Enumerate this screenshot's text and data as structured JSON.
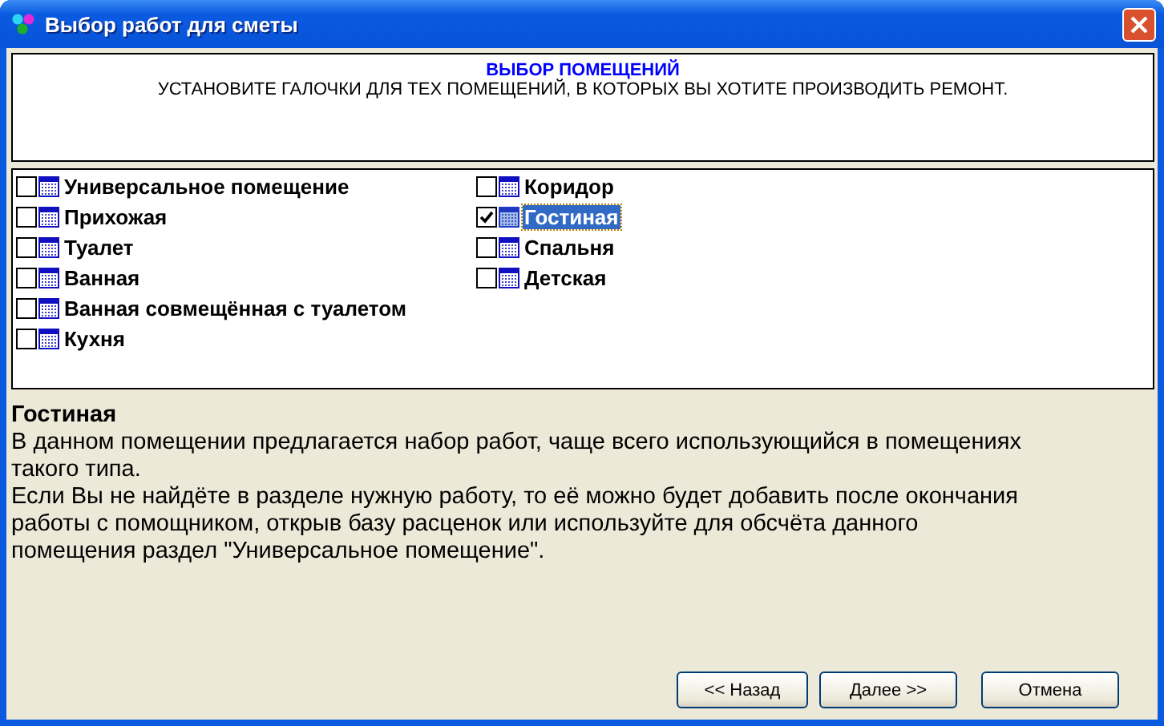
{
  "window": {
    "title": "Выбор работ для сметы"
  },
  "header": {
    "title": "ВЫБОР ПОМЕЩЕНИЙ",
    "instruction": "УСТАНОВИТЕ ГАЛОЧКИ ДЛЯ ТЕХ ПОМЕЩЕНИЙ, В КОТОРЫХ ВЫ ХОТИТЕ ПРОИЗВОДИТЬ РЕМОНТ."
  },
  "rooms": [
    {
      "label": "Универсальное помещение",
      "checked": false,
      "selected": false
    },
    {
      "label": "Прихожая",
      "checked": false,
      "selected": false
    },
    {
      "label": "Туалет",
      "checked": false,
      "selected": false
    },
    {
      "label": "Ванная",
      "checked": false,
      "selected": false
    },
    {
      "label": "Ванная совмещённая с туалетом",
      "checked": false,
      "selected": false
    },
    {
      "label": "Кухня",
      "checked": false,
      "selected": false
    },
    {
      "label": "Коридор",
      "checked": false,
      "selected": false
    },
    {
      "label": "Гостиная",
      "checked": true,
      "selected": true
    },
    {
      "label": "Спальня",
      "checked": false,
      "selected": false
    },
    {
      "label": "Детская",
      "checked": false,
      "selected": false
    }
  ],
  "description": {
    "title": "Гостиная",
    "paragraphs": [
      "В данном помещении предлагается набор работ, чаще всего использующийся в помещениях такого типа.",
      "Если Вы не найдёте в разделе нужную работу, то её можно будет добавить после окончания работы с помощником, открыв базу расценок или используйте для обсчёта данного помещения раздел \"Универсальное помещение\"."
    ]
  },
  "buttons": [
    "<< Назад",
    "Далее >>",
    "Отмена"
  ]
}
